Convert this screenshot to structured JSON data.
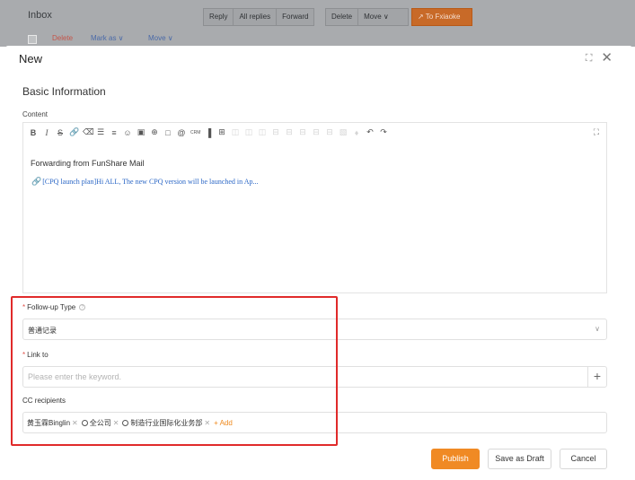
{
  "background": {
    "title": "Inbox",
    "actions": [
      "Delete",
      "Mark as ∨",
      "Move ∨"
    ],
    "toolbar": [
      "Reply",
      "All replies",
      "Forward"
    ],
    "toolbar2": [
      "Delete",
      "Move ∨"
    ],
    "to_fxiaoke": "To Fxiaoke"
  },
  "modal": {
    "title": "New",
    "section_title": "Basic Information",
    "content_label": "Content",
    "editor": {
      "text": "Forwarding from FunShare Mail",
      "link_text": "[CPQ launch plan]Hi ALL, The new CPQ version will be launched in Ap..."
    },
    "followup": {
      "label": "Follow-up Type",
      "value": "普通记录"
    },
    "link_to": {
      "label": "Link to",
      "placeholder": "Please enter the keyword."
    },
    "cc": {
      "label": "CC recipients",
      "recipients": [
        "黄玉霖Binglin",
        "全公司",
        "制造行业国际化业务部"
      ],
      "add_label": "+ Add"
    },
    "buttons": {
      "publish": "Publish",
      "save_draft": "Save as Draft",
      "cancel": "Cancel"
    }
  },
  "colors": {
    "accent": "#f08a24",
    "highlight": "#e02a2a",
    "link": "#2b67c6"
  }
}
